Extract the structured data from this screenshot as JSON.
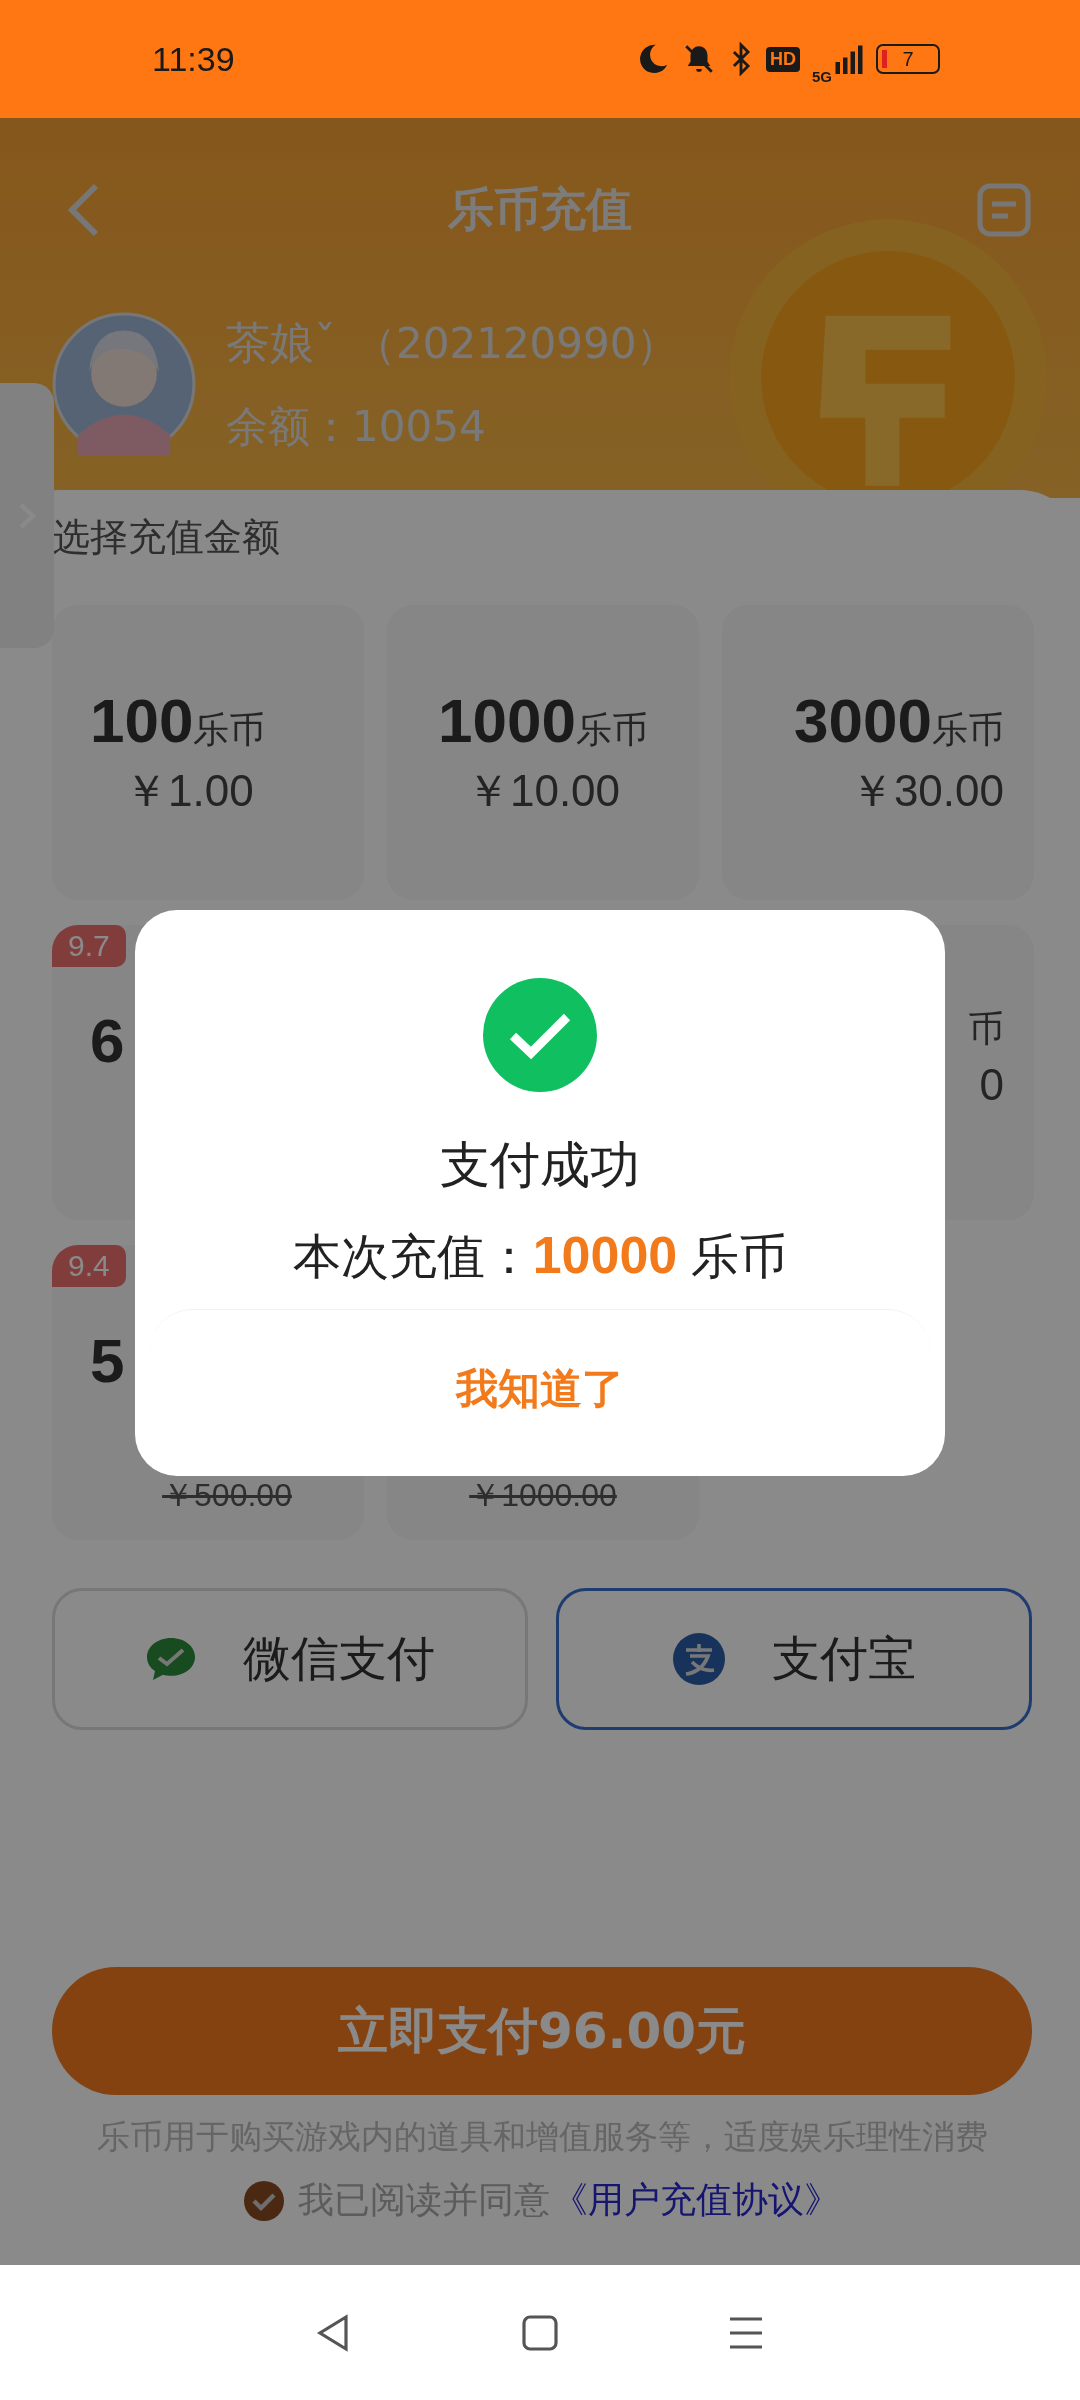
{
  "status_bar": {
    "time": "11:39",
    "hd": "HD",
    "network": "5G",
    "battery": "7"
  },
  "nav": {
    "title": "乐币充值"
  },
  "user": {
    "name": "茶娘ˇ",
    "id": "（202120990）",
    "balance_label": "余额：",
    "balance": "10054"
  },
  "section_title": "选择充值金额",
  "packages": [
    {
      "kind": "card",
      "amount": "100",
      "unit": "乐币",
      "price": "￥1.00"
    },
    {
      "kind": "card",
      "amount": "1000",
      "unit": "乐币",
      "price": "￥10.00"
    },
    {
      "kind": "card",
      "amount": "3000",
      "unit": "乐币",
      "price": "￥30.00"
    },
    {
      "kind": "card",
      "badge": "9.7",
      "amount": "6"
    },
    {
      "kind": "gap"
    },
    {
      "kind": "card",
      "unit": "币",
      "price": "0"
    },
    {
      "kind": "card",
      "badge": "9.4",
      "amount": "5",
      "original": "￥500.00"
    },
    {
      "kind": "card",
      "original": "￥1000.00"
    }
  ],
  "payment_methods": [
    {
      "kind": "wechat",
      "label": "微信支付",
      "selected": false
    },
    {
      "kind": "alipay",
      "label": "支付宝",
      "selected": true
    }
  ],
  "pay_button": "立即支付96.00元",
  "note": "乐币用于购买游戏内的道具和增值服务等，适度娱乐理性消费",
  "agreement": {
    "checked": true,
    "text": "我已阅读并同意",
    "link": "《用户充值协议》"
  },
  "dialog": {
    "title": "支付成功",
    "message_label": "本次充值：",
    "amount": "10000",
    "unit": "乐币",
    "button": "我知道了"
  }
}
